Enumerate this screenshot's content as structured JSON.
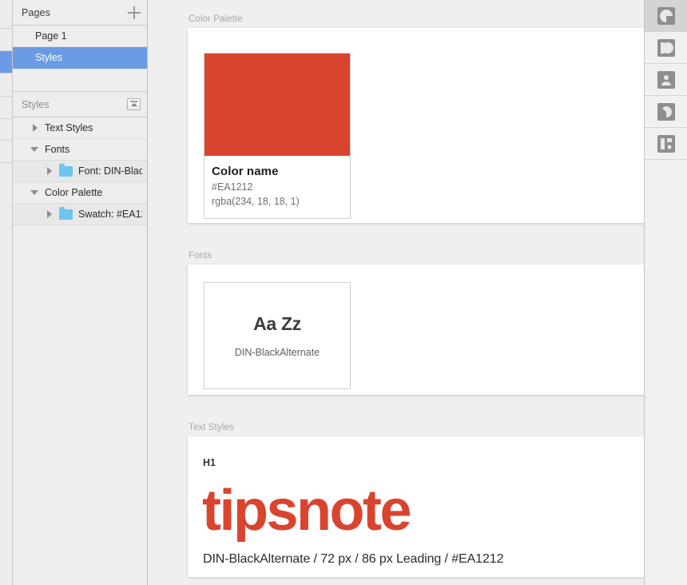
{
  "pages_panel": {
    "title": "Pages",
    "add_button": "add-page",
    "items": [
      {
        "label": "Page 1",
        "selected": false
      },
      {
        "label": "Styles",
        "selected": true
      }
    ]
  },
  "layers_panel": {
    "title": "Styles",
    "collapse_button": "collapse-panel",
    "rows": [
      {
        "label": "Text Styles",
        "disclosure": "right",
        "folder": false,
        "indent": 1
      },
      {
        "label": "Fonts",
        "disclosure": "down",
        "folder": false,
        "indent": 1
      },
      {
        "label": "Font: DIN-Blac...",
        "disclosure": "right",
        "folder": true,
        "indent": 2
      },
      {
        "label": "Color Palette",
        "disclosure": "down",
        "folder": false,
        "indent": 1
      },
      {
        "label": "Swatch: #EA12...",
        "disclosure": "right",
        "folder": true,
        "indent": 2
      }
    ]
  },
  "canvas": {
    "artboards": [
      {
        "label": "Color Palette",
        "swatch": {
          "color": "#d9442f",
          "name": "Color name",
          "hex": "#EA1212",
          "rgba": "rgba(234, 18, 18, 1)"
        }
      },
      {
        "label": "Fonts",
        "font_card": {
          "sample": "Aa Zz",
          "name": "DIN-BlackAlternate"
        }
      },
      {
        "label": "Text Styles",
        "text_style": {
          "tag": "H1",
          "headline": "tipsnote",
          "spec": "DIN-BlackAlternate / 72 px / 86 px Leading / #EA1212",
          "color": "#d9442f"
        }
      }
    ]
  },
  "right_rail": {
    "buttons": [
      {
        "icon": "inspector-styles-icon",
        "active": true
      },
      {
        "icon": "inspector-layout-icon",
        "active": false
      },
      {
        "icon": "inspector-symbol-icon",
        "active": false
      },
      {
        "icon": "inspector-shape-icon",
        "active": false
      },
      {
        "icon": "inspector-components-icon",
        "active": false
      }
    ]
  },
  "colors": {
    "accent_brand": "#EA1212",
    "swatch_rendered": "#d9442f",
    "selection_blue": "#6a9be4",
    "folder_blue": "#6ec6ef"
  }
}
